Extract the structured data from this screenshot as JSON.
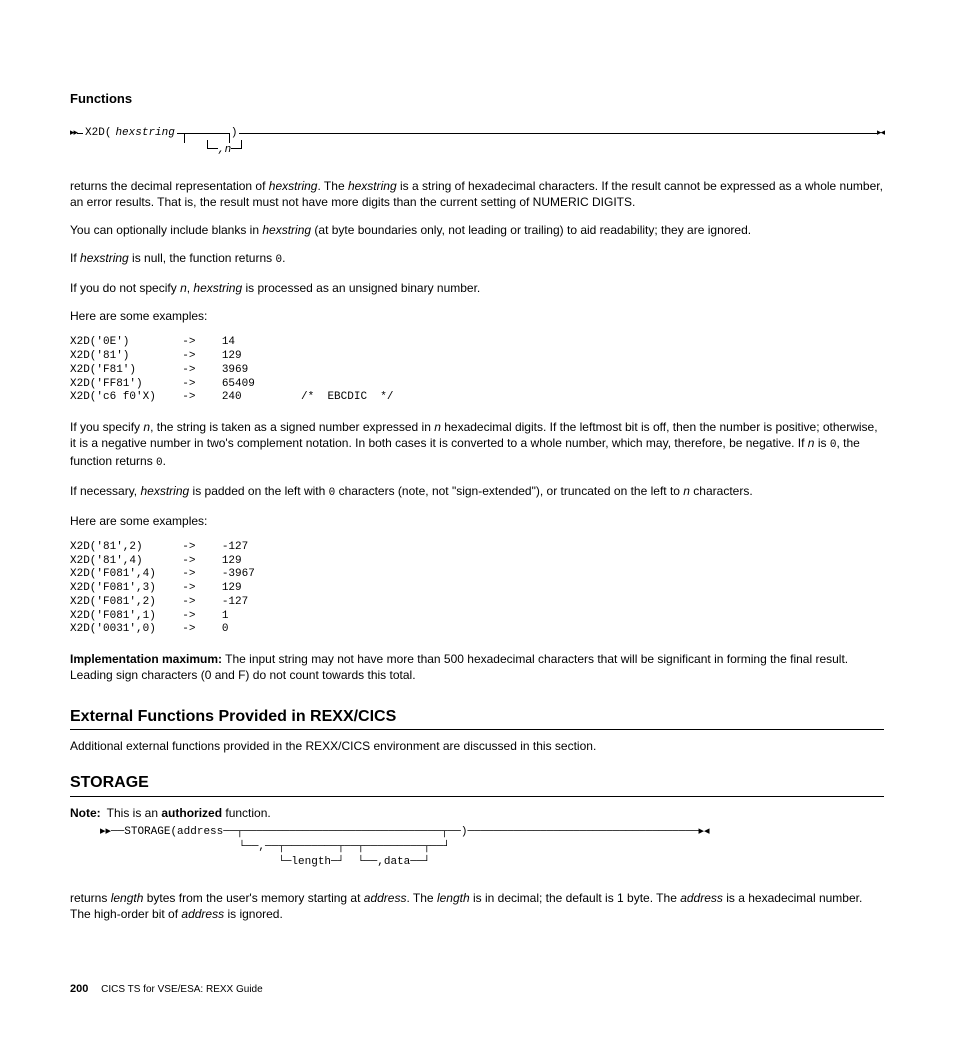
{
  "header": {
    "title": "Functions"
  },
  "syntax1": {
    "func": "X2D(",
    "arg": "hexstring",
    "close": ")",
    "opt": ",n"
  },
  "para1a": "returns the decimal representation of ",
  "para1b": ". The ",
  "para1c": " is a string of hexadecimal characters. If the result cannot be expressed as a whole number, an error results. That is, the result must not have more digits than the current setting of NUMERIC DIGITS.",
  "para2a": "You can optionally include blanks in ",
  "para2b": " (at byte boundaries only, not leading or trailing) to aid readability; they are ignored.",
  "para3a": "If ",
  "para3b": " is null, the function returns ",
  "para3c": ".",
  "zero": "0",
  "para4a": "If you do not specify ",
  "para4b": ", ",
  "para4c": " is processed as an unsigned binary number.",
  "n": "n",
  "hexstring": "hexstring",
  "ex_intro": "Here are some examples:",
  "example1": "X2D('0E')        ->    14\nX2D('81')        ->    129\nX2D('F81')       ->    3969\nX2D('FF81')      ->    65409\nX2D('c6 f0'X)    ->    240         /*  EBCDIC  */",
  "para5a": "If you specify ",
  "para5b": ", the string is taken as a signed number expressed in ",
  "para5c": " hexadecimal digits. If the leftmost bit is off, then the number is positive; otherwise, it is a negative number in two's complement notation. In both cases it is converted to a whole number, which may, therefore, be negative. If ",
  "para5d": " is ",
  "para5e": ", the function returns ",
  "para5f": ".",
  "para6a": "If necessary, ",
  "para6b": " is padded on the left with ",
  "para6c": " characters (note, not \"sign-extended\"), or truncated on the left to ",
  "para6d": " characters.",
  "example2": "X2D('81',2)      ->    -127\nX2D('81',4)      ->    129\nX2D('F081',4)    ->    -3967\nX2D('F081',3)    ->    129\nX2D('F081',2)    ->    -127\nX2D('F081',1)    ->    1\nX2D('0031',0)    ->    0",
  "impl_label": "Implementation maximum:",
  "impl_text": " The input string may not have more than 500 hexadecimal characters that will be significant in forming the final result. Leading sign characters (0 and F) do not count towards this total.",
  "section2": "External Functions Provided in REXX/CICS",
  "section2_text": "Additional external functions provided in the REXX/CICS environment are discussed in this section.",
  "section3": "STORAGE",
  "note_label": "Note:",
  "note_text_a": "This is an ",
  "note_text_b": "authorized",
  "note_text_c": " function.",
  "storage_diag": {
    "line1": "▸▸──STORAGE(address──┬──────────────────────────────┬──)───────────────────────────────────▸◂",
    "line2": "                     └──,──┬────────┬──┬─────────┬──┘",
    "line3": "                           └─length─┘  └──,data──┘"
  },
  "storage_p_a": "returns ",
  "storage_p_b": " bytes from the user's memory starting at ",
  "storage_p_c": ". The ",
  "storage_p_d": " is in decimal; the default is 1 byte. The ",
  "storage_p_e": " is a hexadecimal number. The high-order bit of ",
  "storage_p_f": " is ignored.",
  "length": "length",
  "address": "address",
  "footer": {
    "page": "200",
    "text": "CICS TS for VSE/ESA: REXX Guide"
  }
}
